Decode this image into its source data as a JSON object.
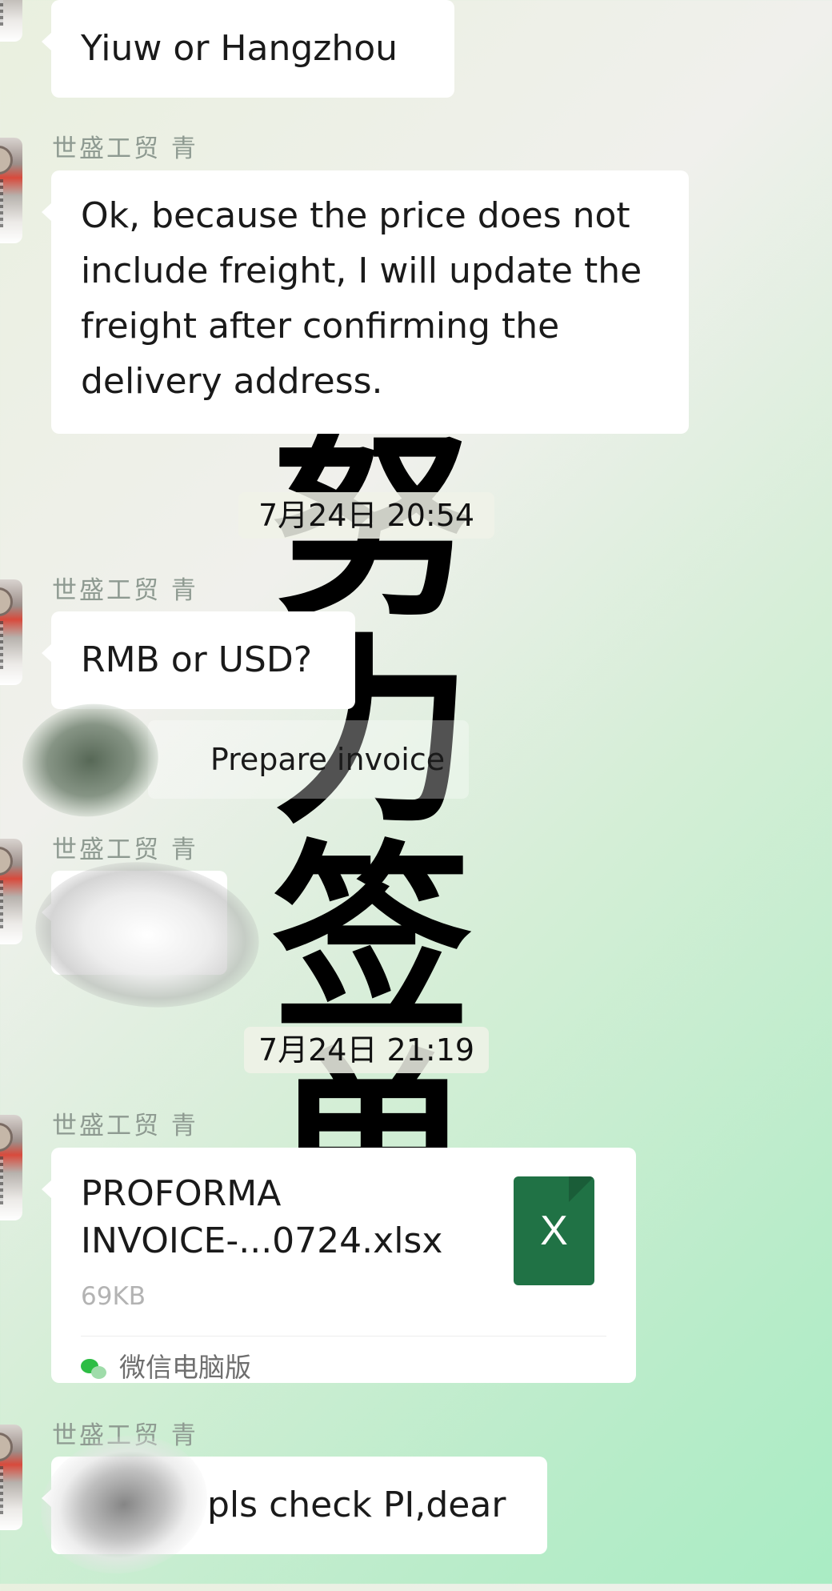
{
  "background_glyphs": [
    "努",
    "力",
    "签",
    "单"
  ],
  "messages": [
    {
      "sender": "",
      "text": "Yiuw or Hangzhou"
    },
    {
      "sender": "世盛工贸 青",
      "text": "Ok, because the price does not include freight, I will update the freight after confirming the delivery address."
    },
    {
      "sender": "世盛工贸 青",
      "text": "RMB or USD?"
    },
    {
      "sender": "世盛工贸 青",
      "text": ""
    },
    {
      "sender": "世盛工贸 青",
      "type": "file",
      "file_name": "PROFORMA INVOICE-...0724.xlsx",
      "file_size": "69KB",
      "file_icon": "excel-icon",
      "file_icon_letter": "X",
      "source": "微信电脑版",
      "source_icon": "wechat-icon"
    },
    {
      "sender": "世盛工贸 青",
      "text": "pls check PI,dear"
    }
  ],
  "timestamps": [
    "7月24日 20:54",
    "7月24日 21:19"
  ],
  "system_note": "Prepare invoice",
  "colors": {
    "bubble": "#ffffff",
    "sender_text": "#8e9a91",
    "excel_green": "#207245",
    "wechat_green": "#2dbd44"
  }
}
